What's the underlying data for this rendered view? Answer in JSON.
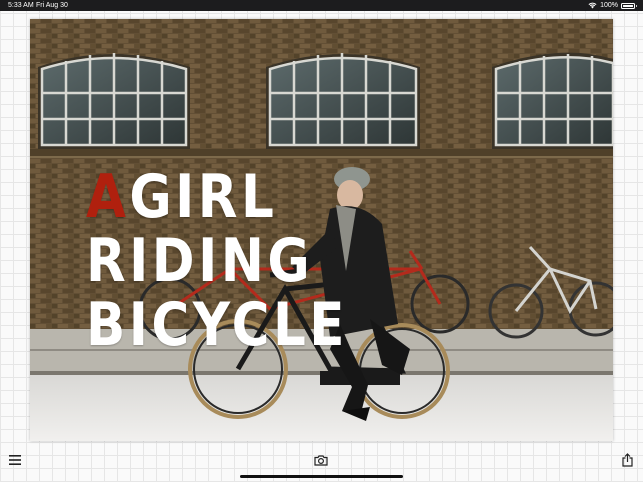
{
  "status_bar": {
    "time": "5:33 AM",
    "date": "Fri Aug 30",
    "battery": "100%",
    "icons": [
      "wifi-icon",
      "battery-icon"
    ]
  },
  "poster": {
    "title_lines": [
      {
        "first": "A",
        "rest": "GIRL"
      },
      {
        "first": "",
        "rest": "RIDING"
      },
      {
        "first": "",
        "rest": "BICYCLE"
      }
    ],
    "colors": {
      "title_text": "#ffffff",
      "accent_red": "#b0200e",
      "brick": "#6e5a3e"
    },
    "image_description_icon": "photo-of-woman-riding-bicycle"
  },
  "toolbar": {
    "icons": [
      "menu-icon",
      "camera-icon",
      "share-icon"
    ]
  }
}
